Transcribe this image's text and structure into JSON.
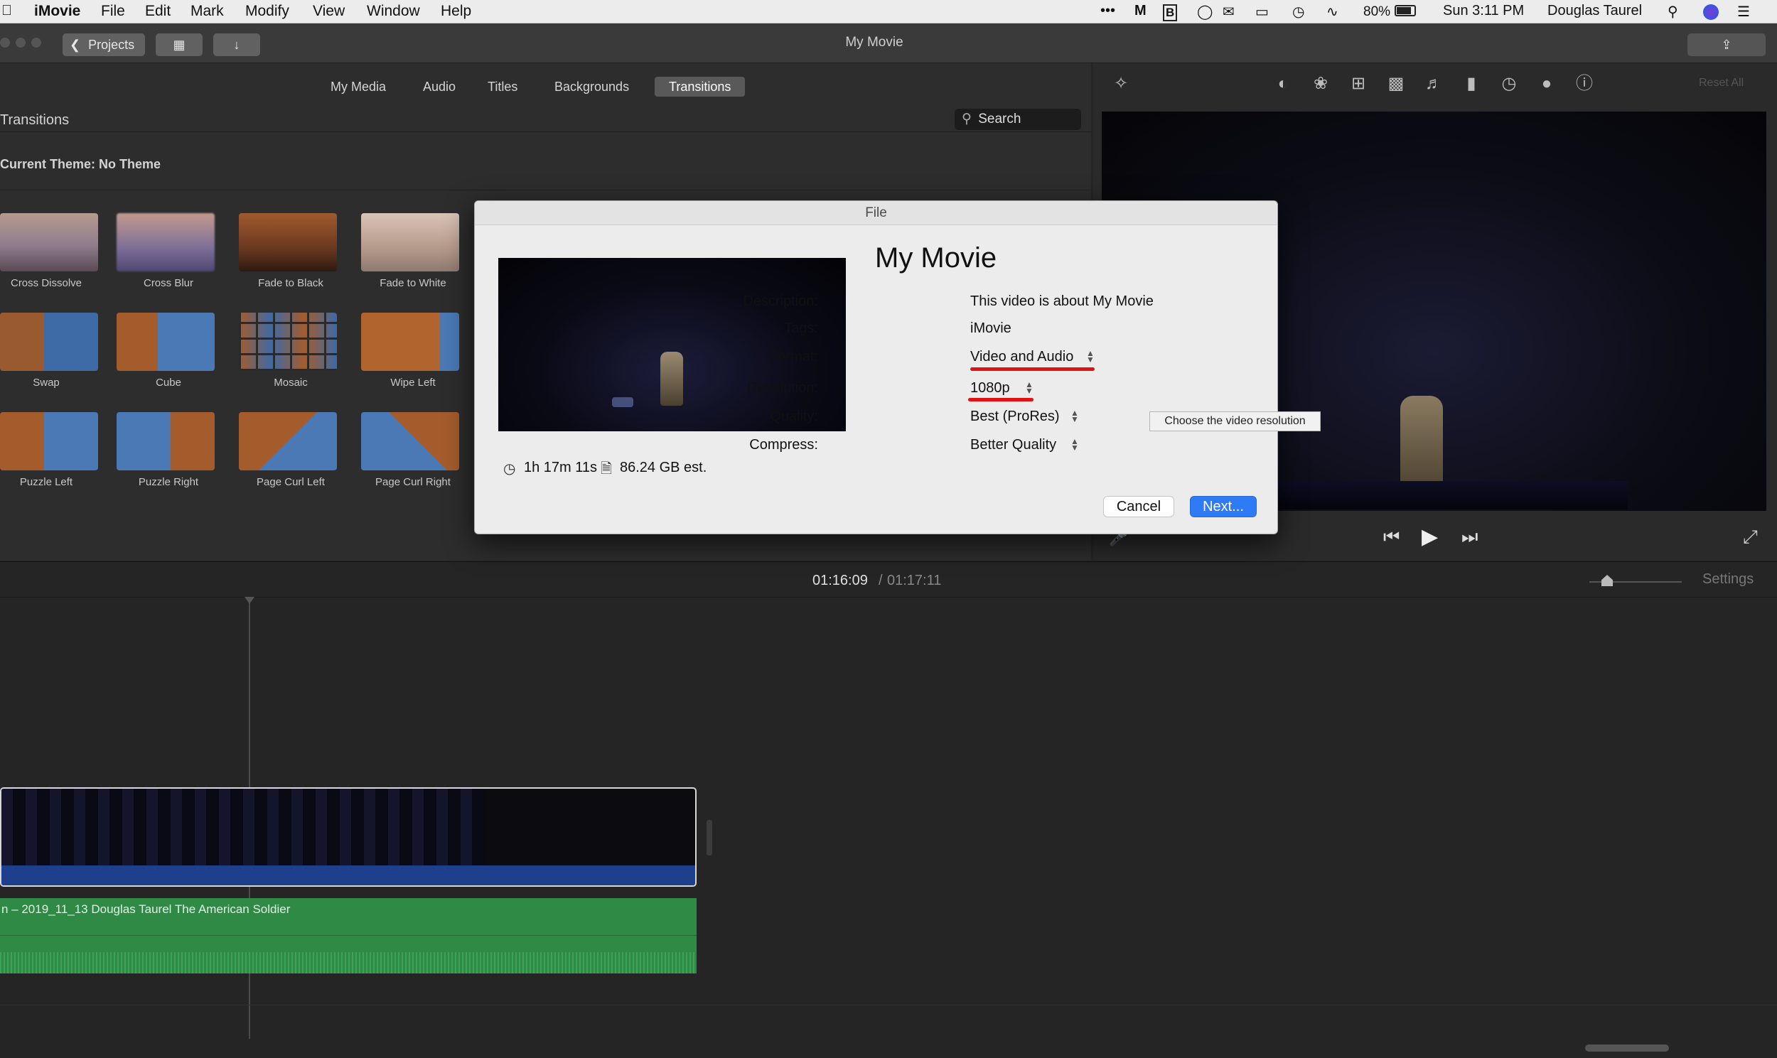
{
  "menubar": {
    "app": "iMovie",
    "items": [
      "File",
      "Edit",
      "Mark",
      "Modify",
      "View",
      "Window",
      "Help"
    ],
    "battery": "80%",
    "clock": "Sun 3:11 PM",
    "user": "Douglas Taurel"
  },
  "toolbar": {
    "projects_label": "Projects",
    "window_title": "My Movie"
  },
  "browser": {
    "tabs": [
      "My Media",
      "Audio",
      "Titles",
      "Backgrounds",
      "Transitions"
    ],
    "selected_tab": "Transitions",
    "section_title": "Transitions",
    "search_placeholder": "Search",
    "theme_label": "Current Theme: No Theme",
    "transitions": [
      "Cross Dissolve",
      "Cross Blur",
      "Fade to Black",
      "Fade to White",
      "Swap",
      "Cube",
      "Mosaic",
      "Wipe Left",
      "Puzzle Left",
      "Puzzle Right",
      "Page Curl Left",
      "Page Curl Right"
    ]
  },
  "viewer": {
    "reset_label": "Reset All"
  },
  "dialog": {
    "title": "File",
    "movie_title": "My Movie",
    "duration": "1h 17m 11s",
    "file_size": "86.24 GB est.",
    "fields": {
      "description_label": "Description:",
      "description_value": "This video is about My Movie",
      "tags_label": "Tags:",
      "tags_value": "iMovie",
      "format_label": "Format:",
      "format_value": "Video and Audio",
      "resolution_label": "Resolution:",
      "resolution_value": "1080p",
      "quality_label": "Quality:",
      "quality_value": "Best (ProRes)",
      "compress_label": "Compress:",
      "compress_value": "Better Quality"
    },
    "cancel_label": "Cancel",
    "next_label": "Next...",
    "tooltip": "Choose the video resolution"
  },
  "timeline": {
    "current_time": "01:16:09",
    "separator": "/",
    "total_time": "01:17:11",
    "settings_label": "Settings",
    "audio_clip_label": "n – 2019_11_13 Douglas Taurel The American Soldier"
  },
  "colors": {
    "accent_blue": "#2f7bf5",
    "annotation_red": "#e01212",
    "audio_green": "#2e8a45",
    "video_blue": "#1e3f8c"
  }
}
